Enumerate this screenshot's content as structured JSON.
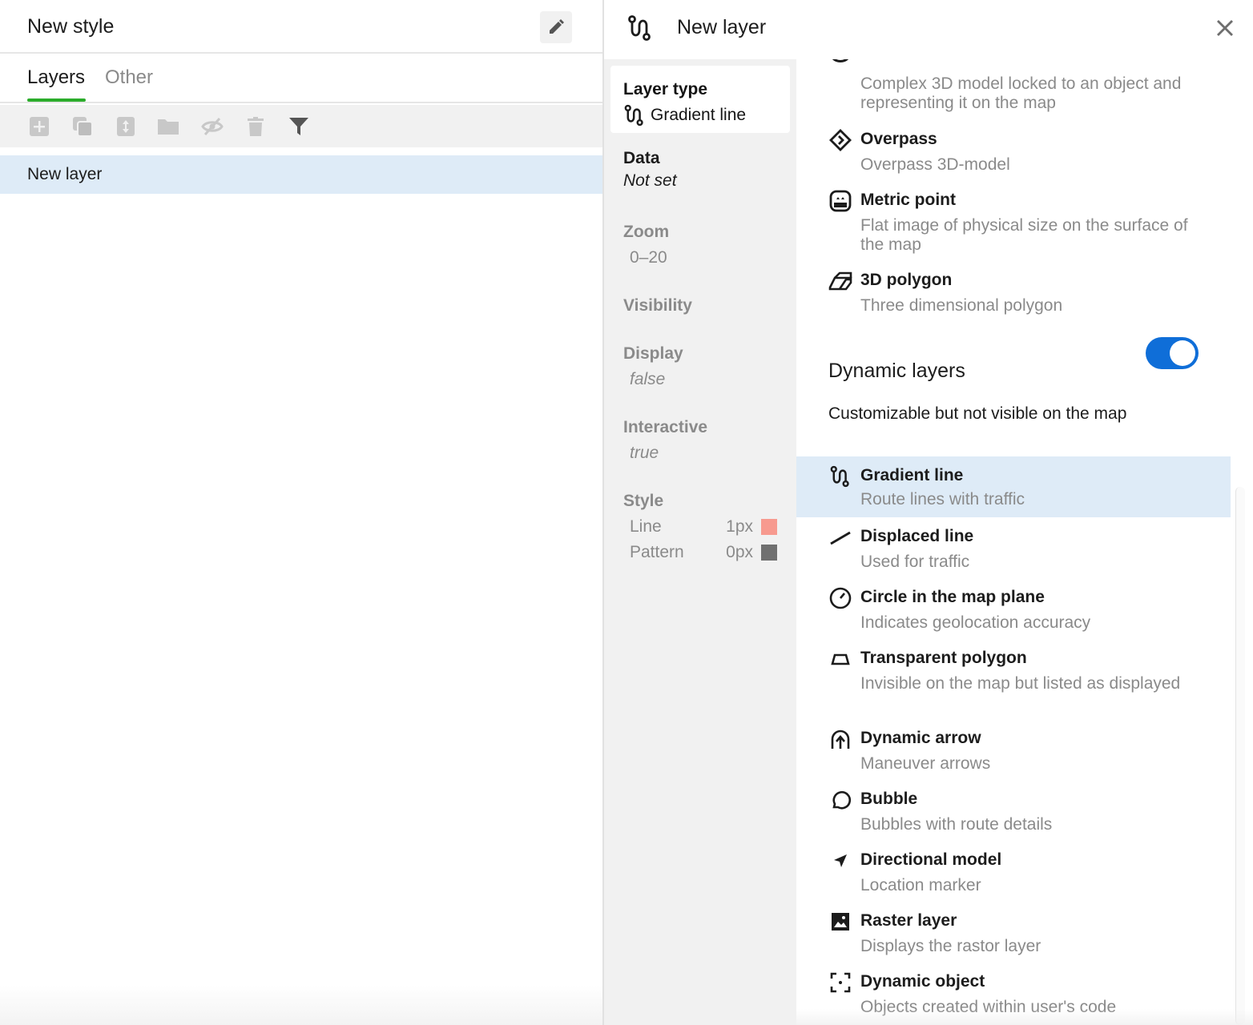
{
  "left_panel": {
    "style_title": "New style",
    "tabs": [
      {
        "label": "Layers",
        "active": true
      },
      {
        "label": "Other",
        "active": false
      }
    ],
    "toolbar_icons": [
      "add-layer-icon",
      "duplicate-icon",
      "move-icon",
      "folder-icon",
      "hide-icon",
      "delete-icon",
      "filter-icon"
    ],
    "layers": [
      {
        "label": "New layer",
        "selected": true
      }
    ]
  },
  "right_panel": {
    "title": "New layer",
    "properties": {
      "layer_type_label": "Layer type",
      "layer_type_value": "Gradient line",
      "data_label": "Data",
      "data_value": "Not set",
      "zoom_label": "Zoom",
      "zoom_value": "0–20",
      "visibility_label": "Visibility",
      "display_label": "Display",
      "display_value": "false",
      "interactive_label": "Interactive",
      "interactive_value": "true",
      "style_label": "Style",
      "style_rows": [
        {
          "name": "Line",
          "width": "1px",
          "color": "#f79a8f"
        },
        {
          "name": "Pattern",
          "width": "0px",
          "color": "#707070"
        }
      ]
    },
    "layer_types": [
      {
        "name": "",
        "desc": "Complex 3D model locked to an object and representing it on the map",
        "icon": "model-icon"
      },
      {
        "name": "Overpass",
        "desc": "Overpass 3D-model",
        "icon": "overpass-icon"
      },
      {
        "name": "Metric point",
        "desc": "Flat image of physical size on the surface of the map",
        "icon": "metric-point-icon"
      },
      {
        "name": "3D polygon",
        "desc": "Three dimensional polygon",
        "icon": "polygon-3d-icon"
      }
    ],
    "dynamic_section": {
      "title": "Dynamic layers",
      "desc": "Customizable but not visible on the map",
      "toggle_on": true,
      "toggle_color": "#0f6ed8"
    },
    "dynamic_types": [
      {
        "name": "Gradient line",
        "desc": "Route lines with traffic",
        "icon": "gradient-line-icon",
        "selected": true
      },
      {
        "name": "Displaced line",
        "desc": "Used for traffic",
        "icon": "displaced-line-icon"
      },
      {
        "name": "Circle in the map plane",
        "desc": "Indicates geolocation accuracy",
        "icon": "circle-icon"
      },
      {
        "name": "Transparent polygon",
        "desc": "Invisible on the map but listed as displayed",
        "icon": "transparent-polygon-icon"
      },
      {
        "name": "Dynamic arrow",
        "desc": "Maneuver arrows",
        "icon": "dynamic-arrow-icon"
      },
      {
        "name": "Bubble",
        "desc": "Bubbles with route details",
        "icon": "bubble-icon"
      },
      {
        "name": "Directional model",
        "desc": "Location marker",
        "icon": "directional-model-icon"
      },
      {
        "name": "Raster layer",
        "desc": "Displays the rastor layer",
        "icon": "raster-icon"
      },
      {
        "name": "Dynamic object",
        "desc": "Objects created within user's code",
        "icon": "dynamic-object-icon"
      }
    ]
  }
}
